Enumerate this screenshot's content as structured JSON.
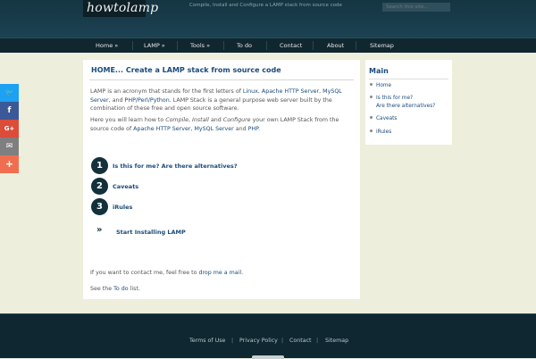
{
  "header": {
    "logo": "howtolamp",
    "tagline": "Compile, Install and Configure a LAMP stack from source code",
    "search_placeholder": "Search this site..."
  },
  "nav": [
    {
      "label": "Home »"
    },
    {
      "label": "LAMP »"
    },
    {
      "label": "Tools »"
    },
    {
      "label": "To do"
    },
    {
      "label": "Contact"
    },
    {
      "label": "About"
    },
    {
      "label": "Sitemap"
    }
  ],
  "share": {
    "twitter_glyph": "🐦",
    "facebook_glyph": "f",
    "google_glyph": "G+",
    "email_glyph": "✉",
    "more_glyph": "+",
    "colors": {
      "twitter": "#1da1f2",
      "facebook": "#3b5998",
      "google": "#dd4b39",
      "email": "#7f7f7f",
      "more": "#ef6e50"
    }
  },
  "main": {
    "title": "HOME... Create a LAMP stack from source code",
    "intro_1a": "LAMP is an acronym that stands for the first letters of ",
    "intro_linux": "Linux",
    "intro_comma1": ", ",
    "intro_apache": "Apache HTTP Server",
    "intro_comma2": ", ",
    "intro_mysql": "MySQL Server",
    "intro_comma3": ",",
    "intro_and": "and ",
    "intro_php": "PHP/Perl/Python",
    "intro_1b": ". LAMP Stack is a general purpose web server built by the combination of these free and open source software.",
    "intro_2a": "Here you will learn how to ",
    "intro_compile": "Compile",
    "intro_sep1": ", ",
    "intro_install": "Install",
    "intro_and2": " and ",
    "intro_configure": "Configure",
    "intro_2b": " your own LAMP Stack from the source code of ",
    "intro_apache2": "Apache HTTP Server",
    "intro_sep2": ", ",
    "intro_mysql2": "MySQL Server",
    "intro_and3": " and ",
    "intro_php2": "PHP",
    "intro_dot": ".",
    "steps": [
      {
        "num": "1",
        "label": "Is this for me? Are there alternatives?"
      },
      {
        "num": "2",
        "label": "Caveats"
      },
      {
        "num": "3",
        "label": "iRules"
      }
    ],
    "start_glyph": "»",
    "start_label": "Start Installing LAMP",
    "contact_a": "If you want to contact me, feel free to ",
    "contact_link": "drop me a mail",
    "contact_b": ".",
    "todo_a": "See the ",
    "todo_link": "To do",
    "todo_b": " list."
  },
  "sidebar": {
    "title": "Main",
    "items": [
      {
        "label": "Home"
      },
      {
        "label": "Is this for me?"
      },
      {
        "label": "Are there alternatives?"
      },
      {
        "label": "Caveats"
      },
      {
        "label": "iRules"
      }
    ]
  },
  "footer": {
    "links": [
      {
        "label": "Terms of Use"
      },
      {
        "label": "Privacy Policy"
      },
      {
        "label": "Contact"
      },
      {
        "label": "Sitemap"
      }
    ],
    "separator": "|"
  }
}
